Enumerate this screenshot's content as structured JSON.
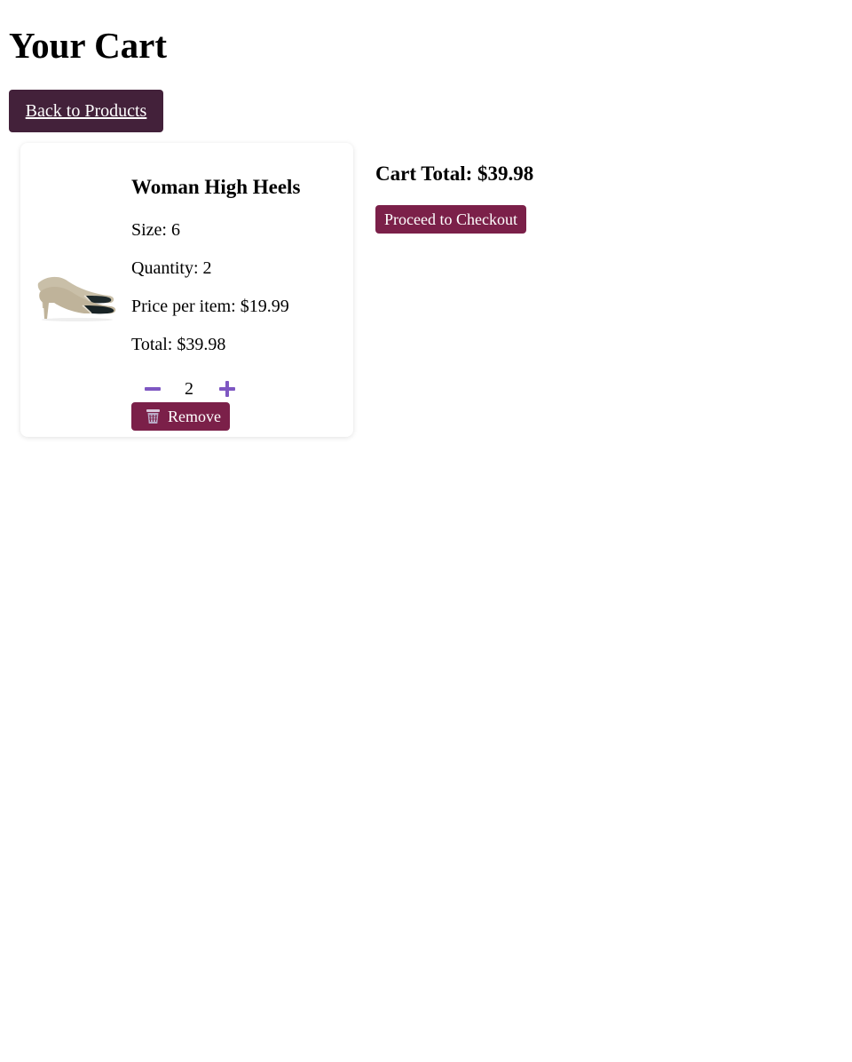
{
  "header": {
    "title": "Your Cart",
    "back_label": "Back to Products"
  },
  "cart": {
    "items": [
      {
        "name": "Woman High Heels",
        "image_icon": "high-heels-image",
        "size_text": "Size: 6",
        "quantity_text": "Quantity: 2",
        "price_text": "Price per item: $19.99",
        "total_text": "Total: $39.98",
        "quantity_value": "2",
        "decrement_icon": "minus-icon",
        "increment_icon": "plus-icon",
        "remove_icon": "trash-icon",
        "remove_label": "Remove"
      }
    ]
  },
  "summary": {
    "total_text": "Cart Total: $39.98",
    "checkout_label": "Proceed to Checkout"
  },
  "colors": {
    "back_button_bg": "#43213a",
    "action_button_bg": "#7b2049",
    "qty_icon": "#7e57c2"
  }
}
